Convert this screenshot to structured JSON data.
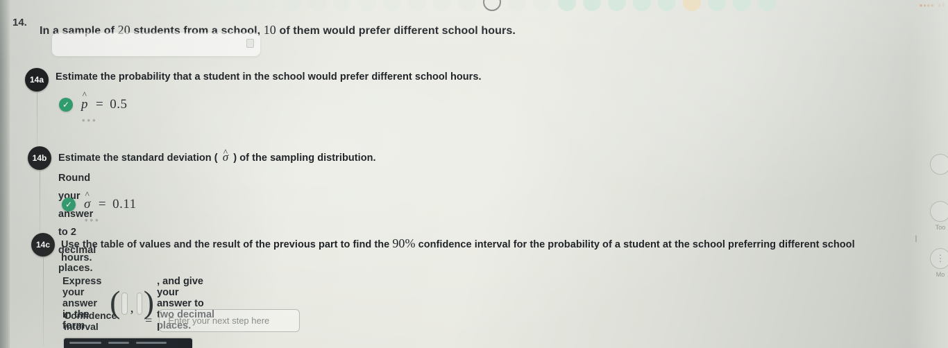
{
  "question": {
    "number": "14.",
    "stem_part1": "In a sample of ",
    "stem_sample_size": "20",
    "stem_part2": " students from a school, ",
    "stem_count": "10",
    "stem_part3": " of them would prefer different school hours."
  },
  "parts": [
    {
      "badge": "14a",
      "prompt": "Estimate the probability that a student in the school would prefer different school hours.",
      "answer_symbol": "p",
      "answer_hat": "^",
      "answer_equals": "=",
      "answer_value": "0.5",
      "status": "correct",
      "check_glyph": "✓",
      "ellipsis": "•••"
    },
    {
      "badge": "14b",
      "prompt_before": "Estimate the standard deviation ( ",
      "prompt_symbol": "σ",
      "prompt_hat": "^",
      "prompt_after": " ) of the sampling distribution.",
      "prompt_line2": "Round your answer to 2 decimal places.",
      "answer_symbol": "σ",
      "answer_hat": "^",
      "answer_equals": "=",
      "answer_value": "0.11",
      "status": "correct",
      "check_glyph": "✓",
      "ellipsis": "•••"
    },
    {
      "badge": "14c",
      "prompt_line1_a": "Use the table of values and the result of the previous part to find the ",
      "prompt_confidence_level": "90%",
      "prompt_line1_b": " confidence interval for the probability of a student at the school preferring different school",
      "prompt_line2": "hours.",
      "form_label": "Express your answer in the form",
      "form_open_paren": "(",
      "form_comma": ",",
      "form_close_paren": ")",
      "form_tail": ", and give your answer to two decimal places.",
      "input_label": "Confidence interval",
      "input_equals": "=",
      "input_value": "",
      "input_placeholder": "Enter your next step here"
    }
  ],
  "right_rail": [
    {
      "icon_glyph": "?",
      "label": ""
    },
    {
      "icon_glyph": "",
      "label": "Too"
    },
    {
      "icon_glyph": "⋮",
      "label": "Mo"
    }
  ],
  "top_badge": {
    "text": "▪▪▪▪ x4",
    "color": "#c0703a"
  },
  "top_dots": [
    "faint",
    "faint",
    "faint",
    "faint",
    "faint",
    "faint",
    "faint",
    "faint",
    "faint",
    "faint",
    "faint",
    "ring",
    "faint",
    "faint",
    "green",
    "green",
    "green",
    "green",
    "green",
    "orange",
    "green",
    "green",
    "green"
  ],
  "colors": {
    "badge_dark": "#1e1f21",
    "check_green": "#2e9c6d",
    "text": "#21252a",
    "placeholder": "#8a8f8a",
    "screen_bg": "#e7e8e0"
  }
}
